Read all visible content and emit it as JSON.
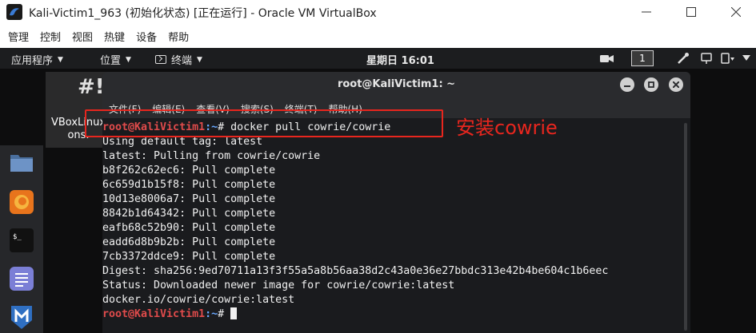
{
  "window": {
    "title": "Kali-Victim1_963 (初始化状态) [正在运行] - Oracle VM VirtualBox",
    "menu": [
      "管理",
      "控制",
      "视图",
      "热键",
      "设备",
      "帮助"
    ]
  },
  "guest_topbar": {
    "applications": "应用程序",
    "places": "位置",
    "terminal": "终端",
    "clock": "星期日 16:01",
    "workspace": "1"
  },
  "desktop_icon": {
    "label": "VBoxLinuxAdditions.run",
    "label_visible": "VBoxLinux\nons."
  },
  "dock": {
    "items": [
      "files-icon",
      "firefox-icon",
      "terminal-icon",
      "text-editor-icon",
      "metasploit-icon"
    ]
  },
  "terminal": {
    "title": "root@KaliVictim1: ~",
    "menu": [
      "文件(F)",
      "编辑(E)",
      "查看(V)",
      "搜索(S)",
      "终端(T)",
      "帮助(H)"
    ],
    "prompt_user": "root@KaliVictim1",
    "prompt_path": ":~",
    "prompt_symbol": "#",
    "command": " docker pull cowrie/cowrie",
    "output": [
      "Using default tag: latest",
      "latest: Pulling from cowrie/cowrie",
      "b8f262c62ec6: Pull complete",
      "6c659d1b15f8: Pull complete",
      "10d13e8006a7: Pull complete",
      "8842b1d64342: Pull complete",
      "eafb68c52b90: Pull complete",
      "eadd6d8b9b2b: Pull complete",
      "7cb3372ddce9: Pull complete",
      "Digest: sha256:9ed70711a13f3f55a5a8b56aa38d2c43a0e36e27bbdc313e42b4be604c1b6eec",
      "Status: Downloaded newer image for cowrie/cowrie:latest",
      "docker.io/cowrie/cowrie:latest"
    ]
  },
  "annotation": {
    "text": "安装cowrie",
    "color": "#e8261e"
  }
}
